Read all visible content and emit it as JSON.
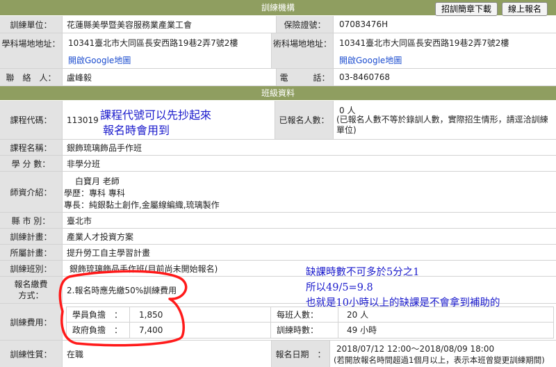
{
  "header": {
    "title": "訓練機構",
    "download_button": "招訓簡章下載",
    "register_button": "線上報名"
  },
  "org": {
    "unit_label": "訓練單位：",
    "unit_value": "花蓮縣美學暨美容服務業產業工會",
    "insurance_label": "保險證號：",
    "insurance_value": "07083476H",
    "classroom_label": "學科場地地址：",
    "classroom_value": "10341臺北市大同區長安西路19巷2弄7號2樓",
    "practice_label": "術科場地地址：",
    "practice_value": "10341臺北市大同區長安西路19巷2弄7號2樓",
    "map_link_1": "開啟Google地圖",
    "map_link_2": "開啟Google地圖",
    "contact_label": "聯　絡　人：",
    "contact_value": "盧峰毅",
    "phone_label": "電　　　話：",
    "phone_value": "03-8460768"
  },
  "section": {
    "title": "班級資料"
  },
  "course": {
    "code_label": "課程代碼：",
    "code_value": "113019",
    "applicants_label": "已報名人數：",
    "applicants_value": "0 人",
    "applicants_note": "(已報名人數不等於錄訓人數，實際招生情形，請逕洽訓練單位)",
    "name_label": "課程名稱：",
    "name_value": "銀飾琉璃飾品手作班",
    "credit_label": "學 分 數：",
    "credit_value": "非學分班",
    "teacher_label": "師資介紹：",
    "teacher_name": "白寶月 老師",
    "teacher_edu": "學歷：專科 專科",
    "teacher_skill": "專長：純銀黏土創作,金屬線編織,琉璃製作",
    "county_label": "縣 市 別：",
    "county_value": "臺北市",
    "plan_label": "訓練計畫：",
    "plan_value": "產業人才投資方案",
    "parent_plan_label": "所屬計畫：",
    "parent_plan_value": "提升勞工自主學習計畫",
    "class_label": "訓練班別：",
    "class_value": "銀飾琉璃飾品手作班(目前尚未開始報名)",
    "payment_label_1": "報名繳費",
    "payment_label_2": "方式：",
    "payment_value": "2.報名時應先繳50%訓練費用",
    "fee_label": "訓練費用：",
    "student_label": "學員負擔　：",
    "student_value": "1,850",
    "gov_label": "政府負擔　：",
    "gov_value": "7,400",
    "per_class_label": "每班人數：",
    "per_class_value": "20 人",
    "hours_label": "訓練時數：",
    "hours_value": "49 小時",
    "nature_label": "訓練性質：",
    "nature_value": "在職",
    "date_label": "報名日期　：",
    "date_value": "2018/07/12 12:00～2018/08/09 18:00",
    "date_note": "(若開放報名時間超過1個月以上，表示本班曾變更訓練期間)"
  },
  "annotations": {
    "code_note_1": "課程代號可以先抄起來",
    "code_note_2": "報名時會用到",
    "hours_note_1": "缺課時數不可多於5分之1",
    "hours_note_2": "所以49/5=9.8",
    "hours_note_3": "也就是10小時以上的缺課是不會拿到補助的"
  },
  "colors": {
    "header": "#8f9e60",
    "label_bg": "#e3e3e3",
    "link": "#1b4ccf",
    "annotation": "#1a1acc",
    "circle": "#ff1a1a"
  }
}
